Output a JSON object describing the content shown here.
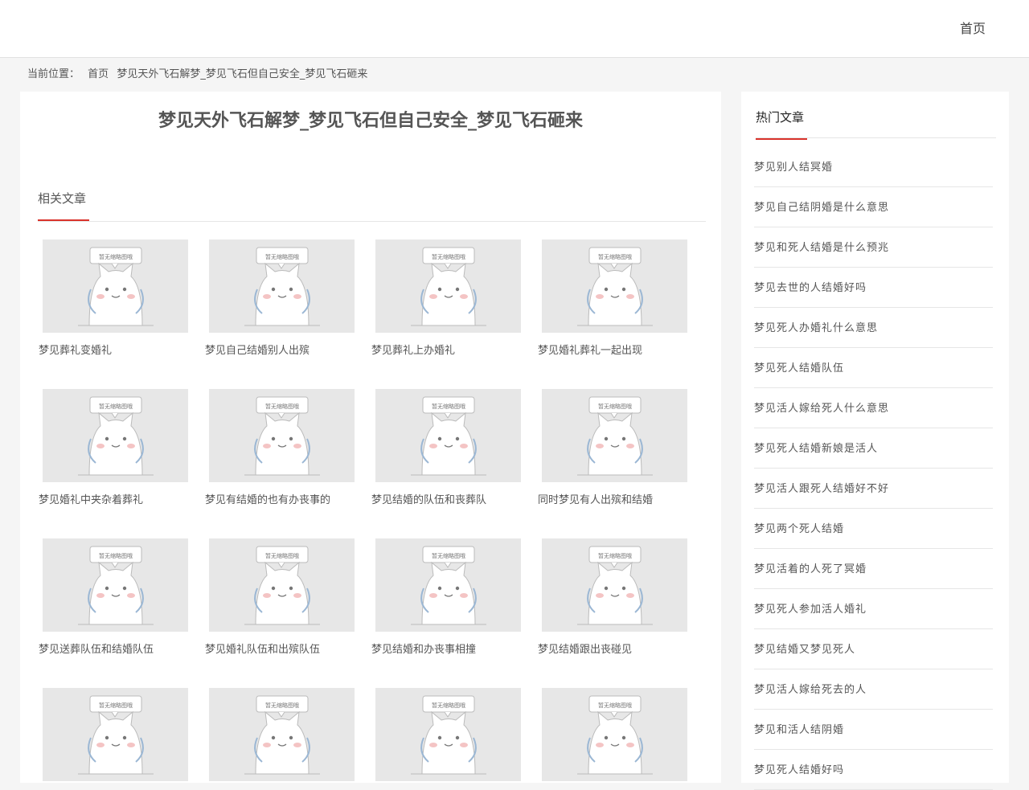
{
  "header": {
    "nav_home": "首页"
  },
  "breadcrumb": {
    "prefix": "当前位置：",
    "home": "首页",
    "current": "梦见天外飞石解梦_梦见飞石但自己安全_梦见飞石砸来"
  },
  "article": {
    "title": "梦见天外飞石解梦_梦见飞石但自己安全_梦见飞石砸来"
  },
  "related": {
    "heading": "相关文章",
    "placeholder_caption": "暂无缩略图哦",
    "items": [
      {
        "title": "梦见葬礼变婚礼"
      },
      {
        "title": "梦见自己结婚别人出殡"
      },
      {
        "title": "梦见葬礼上办婚礼"
      },
      {
        "title": "梦见婚礼葬礼一起出现"
      },
      {
        "title": "梦见婚礼中夹杂着葬礼"
      },
      {
        "title": "梦见有结婚的也有办丧事的"
      },
      {
        "title": "梦见结婚的队伍和丧葬队"
      },
      {
        "title": "同时梦见有人出殡和结婚"
      },
      {
        "title": "梦见送葬队伍和结婚队伍"
      },
      {
        "title": "梦见婚礼队伍和出殡队伍"
      },
      {
        "title": "梦见结婚和办丧事相撞"
      },
      {
        "title": "梦见结婚跟出丧碰见"
      },
      {
        "title": ""
      },
      {
        "title": ""
      },
      {
        "title": ""
      },
      {
        "title": ""
      }
    ]
  },
  "sidebar": {
    "heading": "热门文章",
    "items": [
      "梦见别人结冥婚",
      "梦见自己结阴婚是什么意思",
      "梦见和死人结婚是什么预兆",
      "梦见去世的人结婚好吗",
      "梦见死人办婚礼什么意思",
      "梦见死人结婚队伍",
      "梦见活人嫁给死人什么意思",
      "梦见死人结婚新娘是活人",
      "梦见活人跟死人结婚好不好",
      "梦见两个死人结婚",
      "梦见活着的人死了冥婚",
      "梦见死人参加活人婚礼",
      "梦见结婚又梦见死人",
      "梦见活人嫁给死去的人",
      "梦见和活人结阴婚",
      "梦见死人结婚好吗"
    ]
  },
  "colors": {
    "accent": "#d9322b",
    "background": "#f5f5f5",
    "thumb_bg": "#e7e7e7"
  }
}
